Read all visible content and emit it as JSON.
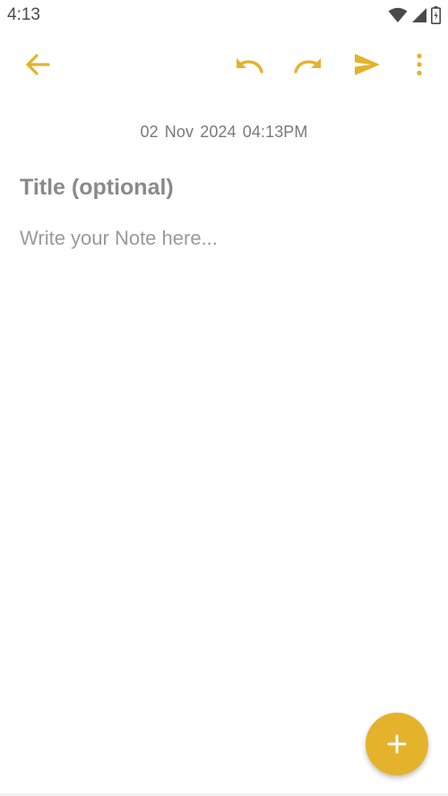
{
  "status_bar": {
    "time": "4:13",
    "icons": [
      "wifi-icon",
      "signal-icon",
      "battery-icon"
    ]
  },
  "toolbar": {
    "accent_color": "#e5b22b",
    "icons": [
      "back-arrow-icon",
      "undo-icon",
      "redo-icon",
      "send-icon",
      "more-vert-icon"
    ]
  },
  "note": {
    "date": "02 Nov 2024",
    "time": "04:13PM",
    "title_value": "",
    "title_placeholder": "Title (optional)",
    "body_value": "",
    "body_placeholder": "Write your Note here..."
  },
  "fab": {
    "icon": "plus-icon",
    "color": "#e5b22b"
  }
}
